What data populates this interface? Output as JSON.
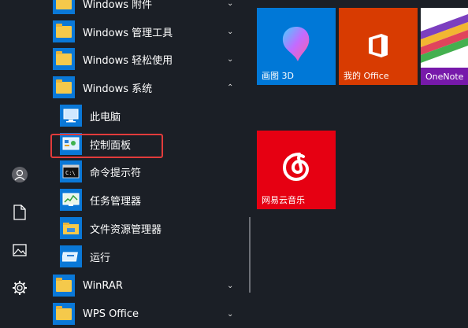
{
  "apps": {
    "groups_top": [
      {
        "label": "Windows 附件",
        "chevron": "chevron-down"
      },
      {
        "label": "Windows 管理工具",
        "chevron": "chevron-down"
      },
      {
        "label": "Windows 轻松使用",
        "chevron": "chevron-down"
      },
      {
        "label": "Windows 系统",
        "chevron": "chevron-up"
      }
    ],
    "system_items": [
      {
        "label": "此电脑",
        "icon": "this-pc-icon"
      },
      {
        "label": "控制面板",
        "icon": "control-panel-icon"
      },
      {
        "label": "命令提示符",
        "icon": "command-prompt-icon"
      },
      {
        "label": "任务管理器",
        "icon": "task-manager-icon"
      },
      {
        "label": "文件资源管理器",
        "icon": "file-explorer-icon"
      },
      {
        "label": "运行",
        "icon": "run-icon"
      }
    ],
    "groups_bottom": [
      {
        "label": "WinRAR",
        "chevron": "chevron-down"
      },
      {
        "label": "WPS Office",
        "chevron": "chevron-down"
      }
    ]
  },
  "tiles": [
    {
      "label": "画图 3D",
      "color": "#0078d7",
      "icon": "paint-3d-icon"
    },
    {
      "label": "我的 Office",
      "color": "#d83b01",
      "icon": "office-icon"
    },
    {
      "label": "OneNote",
      "color": "#ffffff",
      "icon": "onenote-icon"
    },
    {
      "label": "网易云音乐",
      "color": "#e60012",
      "icon": "netease-music-icon"
    }
  ],
  "rail": [
    "user-icon",
    "document-icon",
    "pictures-icon",
    "settings-icon"
  ],
  "colors": {
    "accent": "#0a78d7",
    "highlight": "#e23b3b",
    "background": "#1b1f26"
  }
}
